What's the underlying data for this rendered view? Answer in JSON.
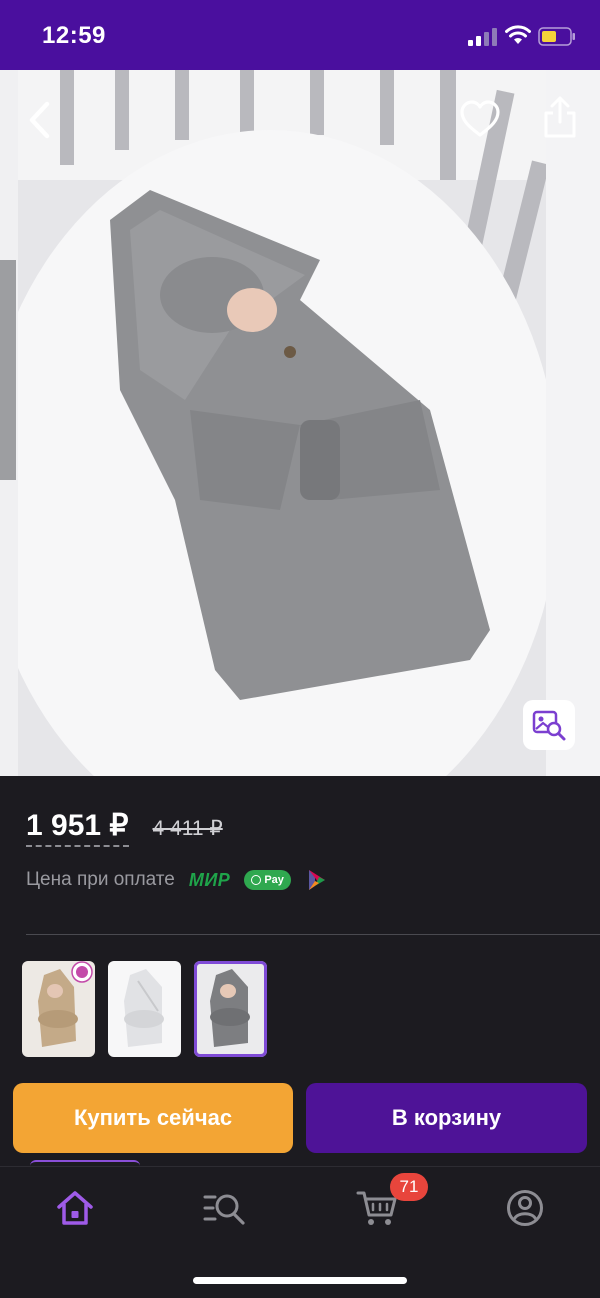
{
  "status_bar": {
    "time": "12:59"
  },
  "product": {
    "price_current": "1 951 ₽",
    "price_old": "4 411 ₽",
    "payment_label": "Цена при оплате",
    "payment_methods": [
      "МИР",
      "Pay"
    ]
  },
  "variants": [
    {
      "color_name": "beige",
      "badge": "bestseller"
    },
    {
      "color_name": "white"
    },
    {
      "color_name": "gray",
      "selected": true
    }
  ],
  "actions": {
    "buy_now_label": "Купить сейчас",
    "add_to_cart_label": "В корзину"
  },
  "tab_bar": {
    "items": [
      "home",
      "catalog-search",
      "cart",
      "profile"
    ],
    "active": "home",
    "cart_count": "71"
  },
  "colors": {
    "status_bar_bg": "#4a0f9e",
    "background": "#1c1b20",
    "buy_now": "#f3a534",
    "add_to_cart": "#4e1397",
    "accent": "#8a4fd8",
    "badge": "#e8453c"
  }
}
